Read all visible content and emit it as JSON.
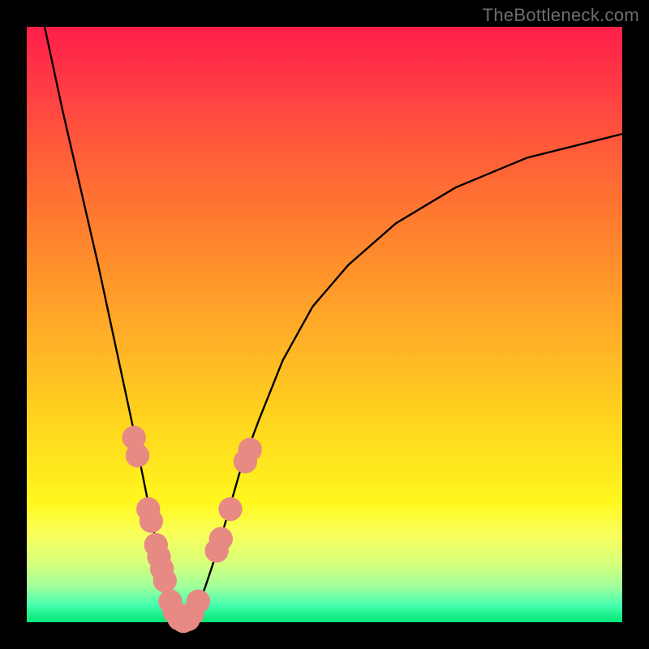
{
  "watermark": "TheBottleneck.com",
  "chart_data": {
    "type": "line",
    "title": "",
    "xlabel": "",
    "ylabel": "",
    "xlim": [
      0,
      100
    ],
    "ylim": [
      0,
      100
    ],
    "grid": false,
    "series": [
      {
        "name": "curve",
        "color": "#000000",
        "x": [
          3,
          6,
          9,
          12,
          15,
          18,
          20,
          22,
          23.5,
          25,
          26,
          27,
          28.5,
          30,
          32,
          34,
          36,
          39,
          43,
          48,
          54,
          62,
          72,
          84,
          100
        ],
        "y": [
          100,
          86,
          73,
          60,
          46,
          32,
          22,
          12,
          6,
          2,
          0.3,
          0.3,
          2,
          6,
          12,
          19,
          26,
          34,
          44,
          53,
          60,
          67,
          73,
          78,
          82
        ]
      }
    ],
    "markers": {
      "name": "highlight-dots",
      "color": "#e88a84",
      "radius": 2.0,
      "points": [
        {
          "x": 18.0,
          "y": 31
        },
        {
          "x": 18.6,
          "y": 28
        },
        {
          "x": 20.4,
          "y": 19
        },
        {
          "x": 20.9,
          "y": 17
        },
        {
          "x": 21.7,
          "y": 13
        },
        {
          "x": 22.2,
          "y": 11
        },
        {
          "x": 22.7,
          "y": 9
        },
        {
          "x": 23.2,
          "y": 7
        },
        {
          "x": 24.1,
          "y": 3.5
        },
        {
          "x": 24.8,
          "y": 1.8
        },
        {
          "x": 25.6,
          "y": 0.6
        },
        {
          "x": 26.3,
          "y": 0.2
        },
        {
          "x": 27.1,
          "y": 0.5
        },
        {
          "x": 27.8,
          "y": 1.5
        },
        {
          "x": 28.8,
          "y": 3.5
        },
        {
          "x": 31.9,
          "y": 12
        },
        {
          "x": 32.6,
          "y": 14
        },
        {
          "x": 34.2,
          "y": 19
        },
        {
          "x": 36.7,
          "y": 27
        },
        {
          "x": 37.5,
          "y": 29
        }
      ]
    }
  }
}
